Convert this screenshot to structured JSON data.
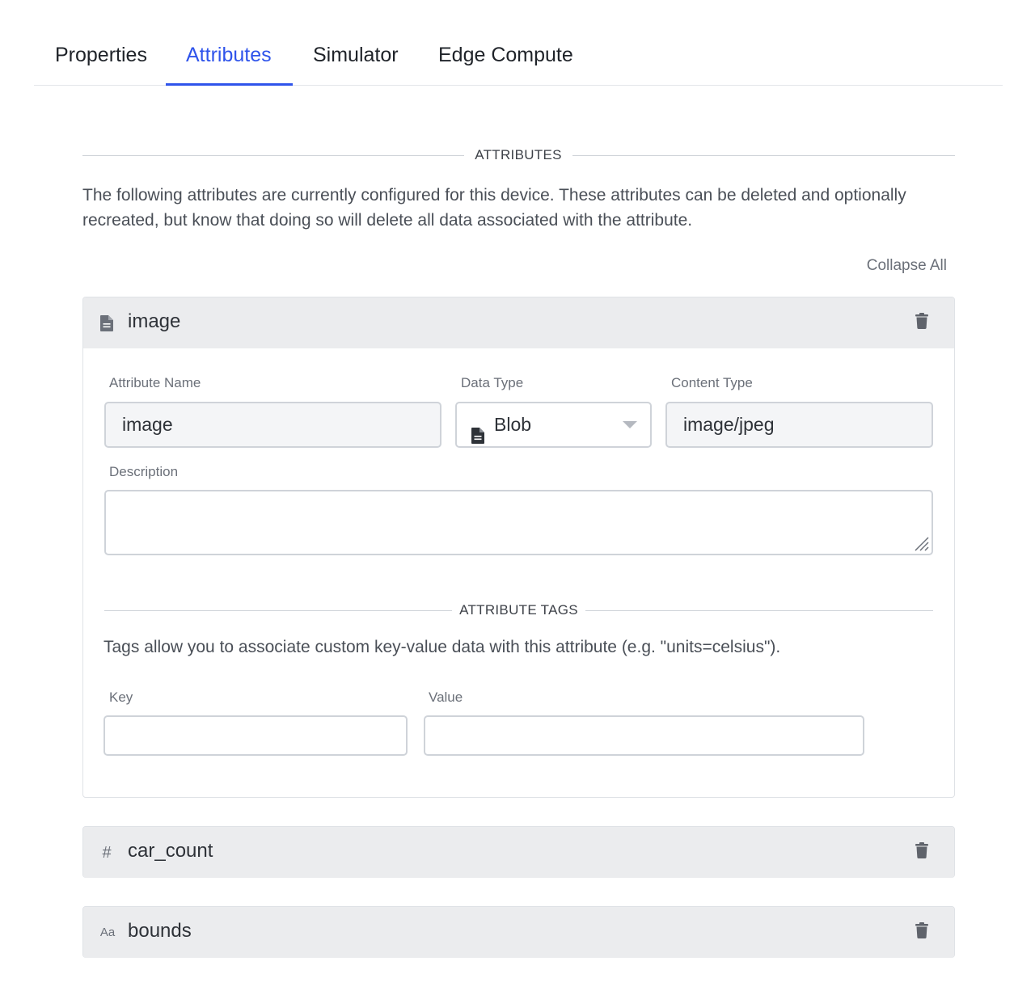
{
  "tabs": [
    {
      "label": "Properties",
      "active": false
    },
    {
      "label": "Attributes",
      "active": true
    },
    {
      "label": "Simulator",
      "active": false
    },
    {
      "label": "Edge Compute",
      "active": false
    }
  ],
  "accent_color": "#2f54eb",
  "attributes_section": {
    "heading": "ATTRIBUTES",
    "intro": "The following attributes are currently configured for this device. These attributes can be deleted and optionally recreated, but know that doing so will delete all data associated with the attribute.",
    "collapse_all": "Collapse All"
  },
  "attributes": [
    {
      "name": "image",
      "type_icon": "file-icon",
      "expanded": true,
      "form": {
        "attribute_name_label": "Attribute Name",
        "attribute_name_value": "image",
        "data_type_label": "Data Type",
        "data_type_value": "Blob",
        "data_type_icon": "file-icon",
        "content_type_label": "Content Type",
        "content_type_value": "image/jpeg",
        "description_label": "Description",
        "description_value": "",
        "tags_heading": "ATTRIBUTE TAGS",
        "tags_help": "Tags allow you to associate custom key-value data with this attribute (e.g. \"units=celsius\").",
        "key_label": "Key",
        "key_value": "",
        "value_label": "Value",
        "value_value": ""
      }
    },
    {
      "name": "car_count",
      "type_icon": "hash-icon",
      "type_glyph": "#",
      "expanded": false
    },
    {
      "name": "bounds",
      "type_icon": "string-icon",
      "type_glyph": "Aa",
      "expanded": false
    }
  ]
}
